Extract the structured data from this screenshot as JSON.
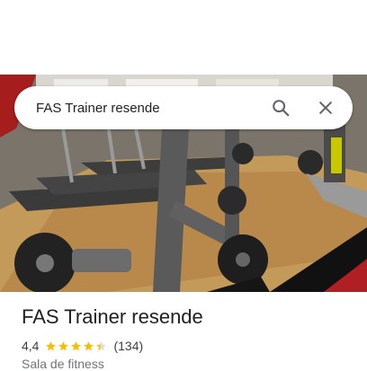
{
  "search": {
    "value": "FAS Trainer resende"
  },
  "icons": {
    "search": "search-icon",
    "close": "close-icon",
    "star": "star-icon"
  },
  "place": {
    "name": "FAS Trainer resende",
    "rating": "4,4",
    "rating_value": 4.4,
    "reviews": "(134)",
    "category": "Sala de fitness"
  },
  "colors": {
    "star": "#fbbc04",
    "title": "#202124",
    "secondary": "#70757a"
  }
}
